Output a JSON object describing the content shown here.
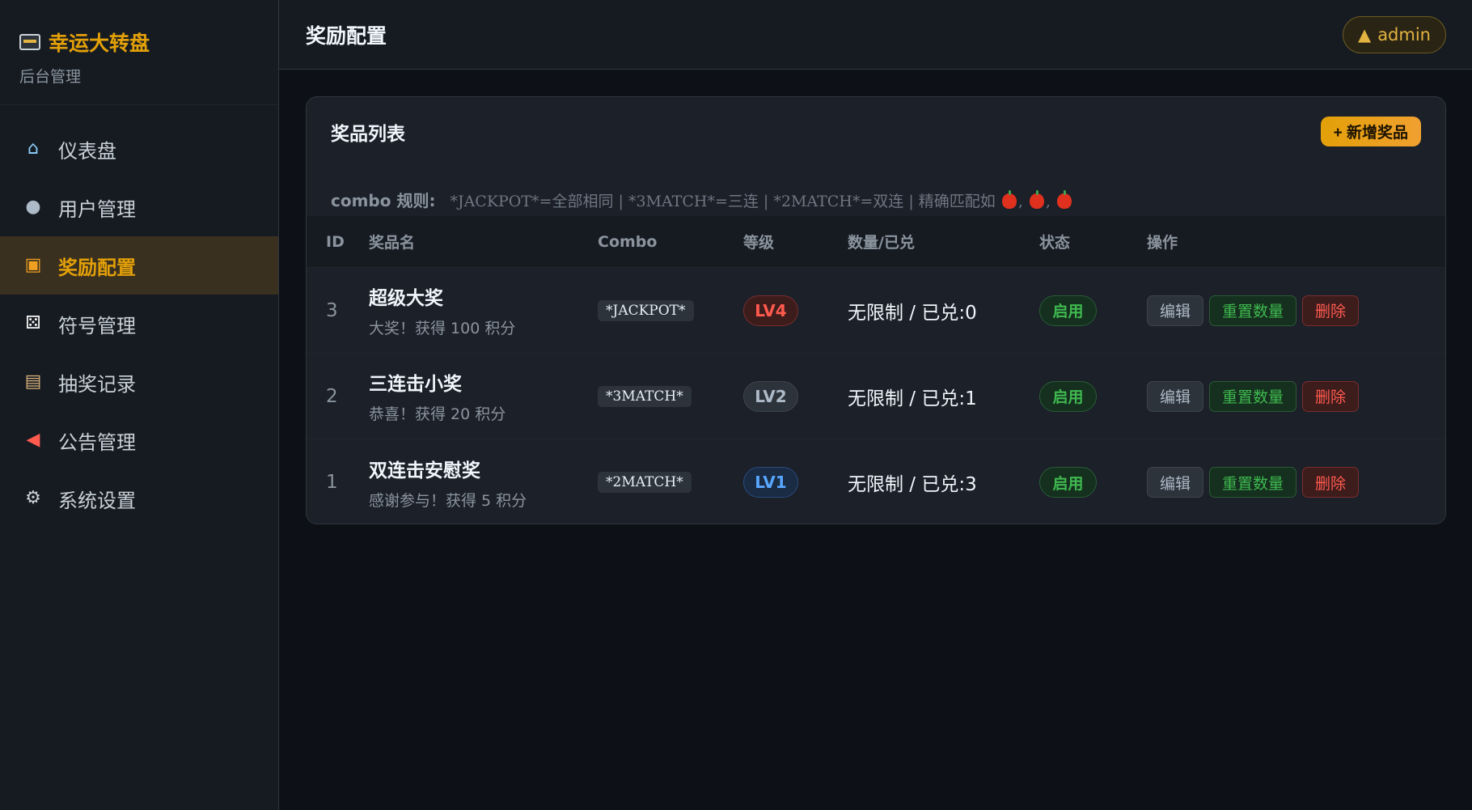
{
  "brand": {
    "title": "幸运大转盘",
    "subtitle": "后台管理",
    "icon": "slot-machine-icon"
  },
  "sidebar": {
    "items": [
      {
        "label": "仪表盘",
        "icon": "house-icon",
        "active": false
      },
      {
        "label": "用户管理",
        "icon": "users-icon",
        "active": false
      },
      {
        "label": "奖励配置",
        "icon": "gift-icon",
        "active": true
      },
      {
        "label": "符号管理",
        "icon": "dice-icon",
        "active": false
      },
      {
        "label": "抽奖记录",
        "icon": "clipboard-icon",
        "active": false
      },
      {
        "label": "公告管理",
        "icon": "megaphone-icon",
        "active": false
      },
      {
        "label": "系统设置",
        "icon": "gear-icon",
        "active": false
      }
    ]
  },
  "header": {
    "title": "奖励配置",
    "user": "admin",
    "user_icon": "▲"
  },
  "card": {
    "title": "奖品列表",
    "add_button": "+ 新增奖品",
    "rule_label": "combo 规则:",
    "rule_text": "*JACKPOT*=全部相同 | *3MATCH*=三连 | *2MATCH*=双连 | 精确匹配如",
    "rule_examples": ", , "
  },
  "table": {
    "columns": [
      "ID",
      "奖品名",
      "Combo",
      "等级",
      "数量/已兑",
      "状态",
      "操作"
    ],
    "rows": [
      {
        "id": "3",
        "name": "超级大奖",
        "desc": "大奖！获得 100 积分",
        "combo": "*JACKPOT*",
        "level": "LV4",
        "qty": "无限制 / 已兑:0",
        "status": "启用"
      },
      {
        "id": "2",
        "name": "三连击小奖",
        "desc": "恭喜！获得 20 积分",
        "combo": "*3MATCH*",
        "level": "LV2",
        "qty": "无限制 / 已兑:1",
        "status": "启用"
      },
      {
        "id": "1",
        "name": "双连击安慰奖",
        "desc": "感谢参与！获得 5 积分",
        "combo": "*2MATCH*",
        "level": "LV1",
        "qty": "无限制 / 已兑:3",
        "status": "启用"
      }
    ],
    "actions": {
      "edit": "编辑",
      "reset": "重置数量",
      "delete": "删除"
    }
  },
  "colors": {
    "accent": "#e3a008",
    "success": "#3fb950",
    "danger": "#ff5a4e",
    "info": "#58a6ff"
  }
}
